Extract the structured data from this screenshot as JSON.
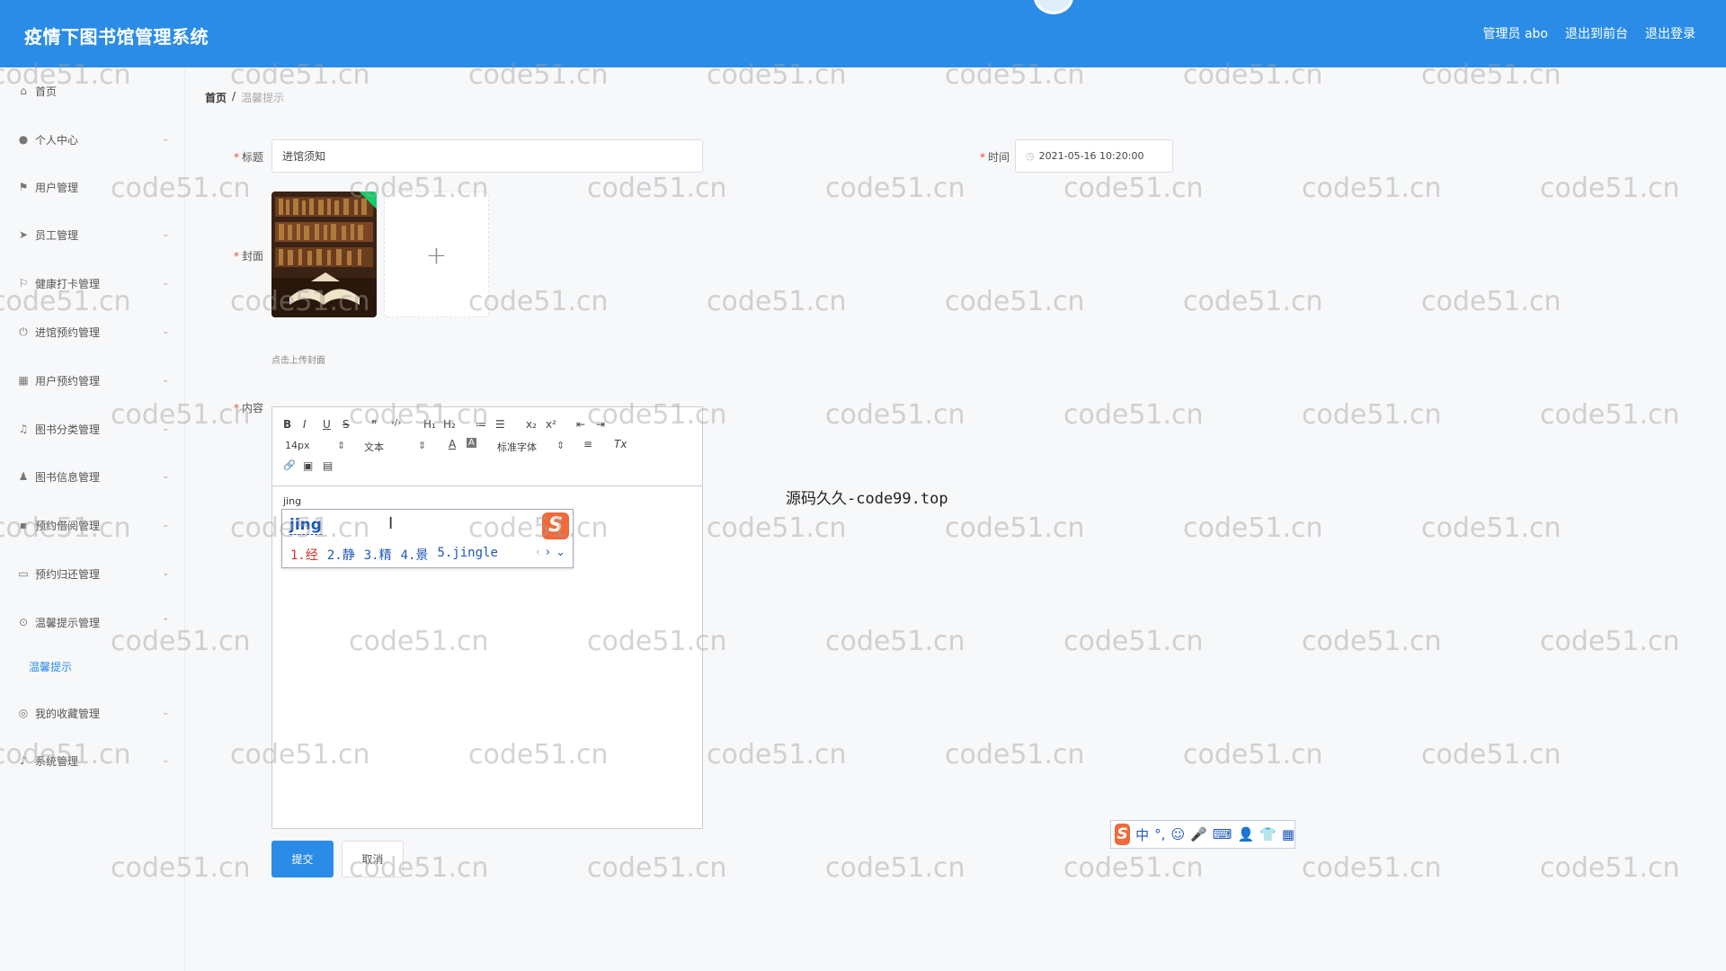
{
  "header": {
    "app_title": "疫情下图书馆管理系统",
    "user_label": "管理员 abo",
    "front_link": "退出到前台",
    "logout_link": "退出登录"
  },
  "sidebar": {
    "items": [
      {
        "label": "首页",
        "icon": "home-icon",
        "expandable": false
      },
      {
        "label": "个人中心",
        "icon": "user-icon",
        "expandable": true
      },
      {
        "label": "用户管理",
        "icon": "users-icon",
        "expandable": false
      },
      {
        "label": "员工管理",
        "icon": "send-icon",
        "expandable": true
      },
      {
        "label": "健康打卡管理",
        "icon": "flag-icon",
        "expandable": true
      },
      {
        "label": "进馆预约管理",
        "icon": "power-icon",
        "expandable": true
      },
      {
        "label": "用户预约管理",
        "icon": "grid-icon",
        "expandable": true
      },
      {
        "label": "图书分类管理",
        "icon": "bell-icon",
        "expandable": true
      },
      {
        "label": "图书信息管理",
        "icon": "person-icon",
        "expandable": true
      },
      {
        "label": "预约借阅管理",
        "icon": "apps-icon",
        "expandable": true
      },
      {
        "label": "预约归还管理",
        "icon": "message-icon",
        "expandable": true
      },
      {
        "label": "温馨提示管理",
        "icon": "help-icon",
        "expandable": true,
        "expanded": true
      },
      {
        "label": "我的收藏管理",
        "icon": "compass-icon",
        "expandable": true
      },
      {
        "label": "系统管理",
        "icon": "mic-icon",
        "expandable": true
      }
    ],
    "submenu": {
      "label": "温馨提示"
    }
  },
  "breadcrumb": {
    "home": "首页",
    "separator": "/",
    "current": "温馨提示"
  },
  "form": {
    "title_label": "标题",
    "title_value": "进馆须知",
    "time_label": "时间",
    "time_value": "2021-05-16 10:20:00",
    "cover_label": "封面",
    "upload_plus": "+",
    "upload_hint": "点击上传封面",
    "content_label": "内容"
  },
  "editor": {
    "toolbar": {
      "bold": "B",
      "italic": "I",
      "underline": "U",
      "strike": "S",
      "quote": "❞",
      "code": "‹/›",
      "h1": "H₁",
      "h2": "H₂",
      "ordered_list": "≔",
      "bullet_list": "☰",
      "sub": "x₂",
      "sup": "x²",
      "outdent": "⇤",
      "indent": "⇥",
      "size": "14px",
      "header": "文本",
      "font_color": "A",
      "bg_color": "A",
      "font": "标准字体",
      "align": "≡",
      "clean": "Tx",
      "link": "🔗",
      "image": "▣",
      "video": "▤"
    },
    "content": "jing"
  },
  "ime": {
    "composition": "jing",
    "candidates": [
      "1.经",
      "2.静",
      "3.精",
      "4.景",
      "5.jingle"
    ],
    "prev": "‹",
    "next": "›",
    "expand": "⌄",
    "logo": "S"
  },
  "ime_bar": {
    "logo": "S",
    "mode": "中",
    "punct": "°,",
    "emoji": "☺",
    "voice": "🎤",
    "keyboard": "⌨",
    "user": "👤",
    "skin": "👕",
    "tools": "▦"
  },
  "watermark": "源码久久-code99.top",
  "bg_watermark": "code51.cn",
  "buttons": {
    "submit": "提交",
    "cancel": "取消"
  },
  "colors": {
    "primary": "#2a8ce6",
    "required": "#e74c3c",
    "check": "#13ce66",
    "ime_brand": "#f06a3a"
  }
}
